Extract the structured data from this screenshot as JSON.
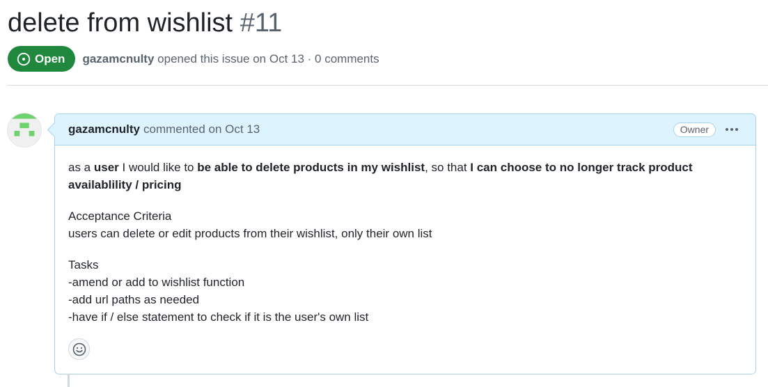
{
  "issue": {
    "title": "delete from wishlist",
    "number": "#11",
    "state": "Open",
    "author": "gazamcnulty",
    "opened_text": "opened this issue on Oct 13 · 0 comments"
  },
  "comment": {
    "author": "gazamcnulty",
    "action": "commented on Oct 13",
    "role_badge": "Owner",
    "story": {
      "p1": "as a ",
      "b1": "user",
      "p2": " I would like to ",
      "b2": "be able to delete products in my wishlist",
      "p3": ", so that ",
      "b3": "I can choose to no longer track product availablility / pricing"
    },
    "acceptance": {
      "heading": "Acceptance Criteria",
      "text": "users can delete or edit products from their wishlist, only their own list"
    },
    "tasks": {
      "heading": "Tasks",
      "items": [
        "-amend or add to wishlist function",
        "-add url paths as needed",
        "-have if / else statement to check if it is the user's own list"
      ]
    }
  },
  "icons": {
    "state": "issue-opened-icon",
    "more": "kebab-horizontal-icon",
    "reaction": "smiley-icon",
    "avatar": "identicon-avatar"
  },
  "colors": {
    "open_green": "#1f883d",
    "comment_header_bg": "#ddf4ff",
    "comment_border": "#a7d2ee",
    "identicon_green": "#6ed36e"
  }
}
